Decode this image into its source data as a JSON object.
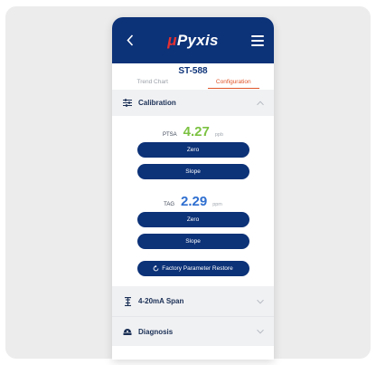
{
  "header": {
    "logo_prefix": "μ",
    "logo_text": "Pyxis"
  },
  "device": {
    "id": "ST-588"
  },
  "tabs": [
    {
      "label": "Trend Chart",
      "active": false
    },
    {
      "label": "Configuration",
      "active": true
    }
  ],
  "calibration": {
    "title": "Calibration",
    "expanded": true,
    "readings": [
      {
        "label": "PTSA",
        "value": "4.27",
        "unit": "ppb",
        "color": "#7cc242",
        "zero_label": "Zero",
        "slope_label": "Slope"
      },
      {
        "label": "TAG",
        "value": "2.29",
        "unit": "ppm",
        "color": "#2f6fd0",
        "zero_label": "Zero",
        "slope_label": "Slope"
      }
    ],
    "restore_label": "Factory Parameter Restore"
  },
  "span": {
    "title": "4-20mA Span",
    "expanded": false
  },
  "diagnosis": {
    "title": "Diagnosis",
    "expanded": false
  },
  "colors": {
    "primary": "#0c3278",
    "accent": "#e0552a",
    "background": "#ececec"
  }
}
